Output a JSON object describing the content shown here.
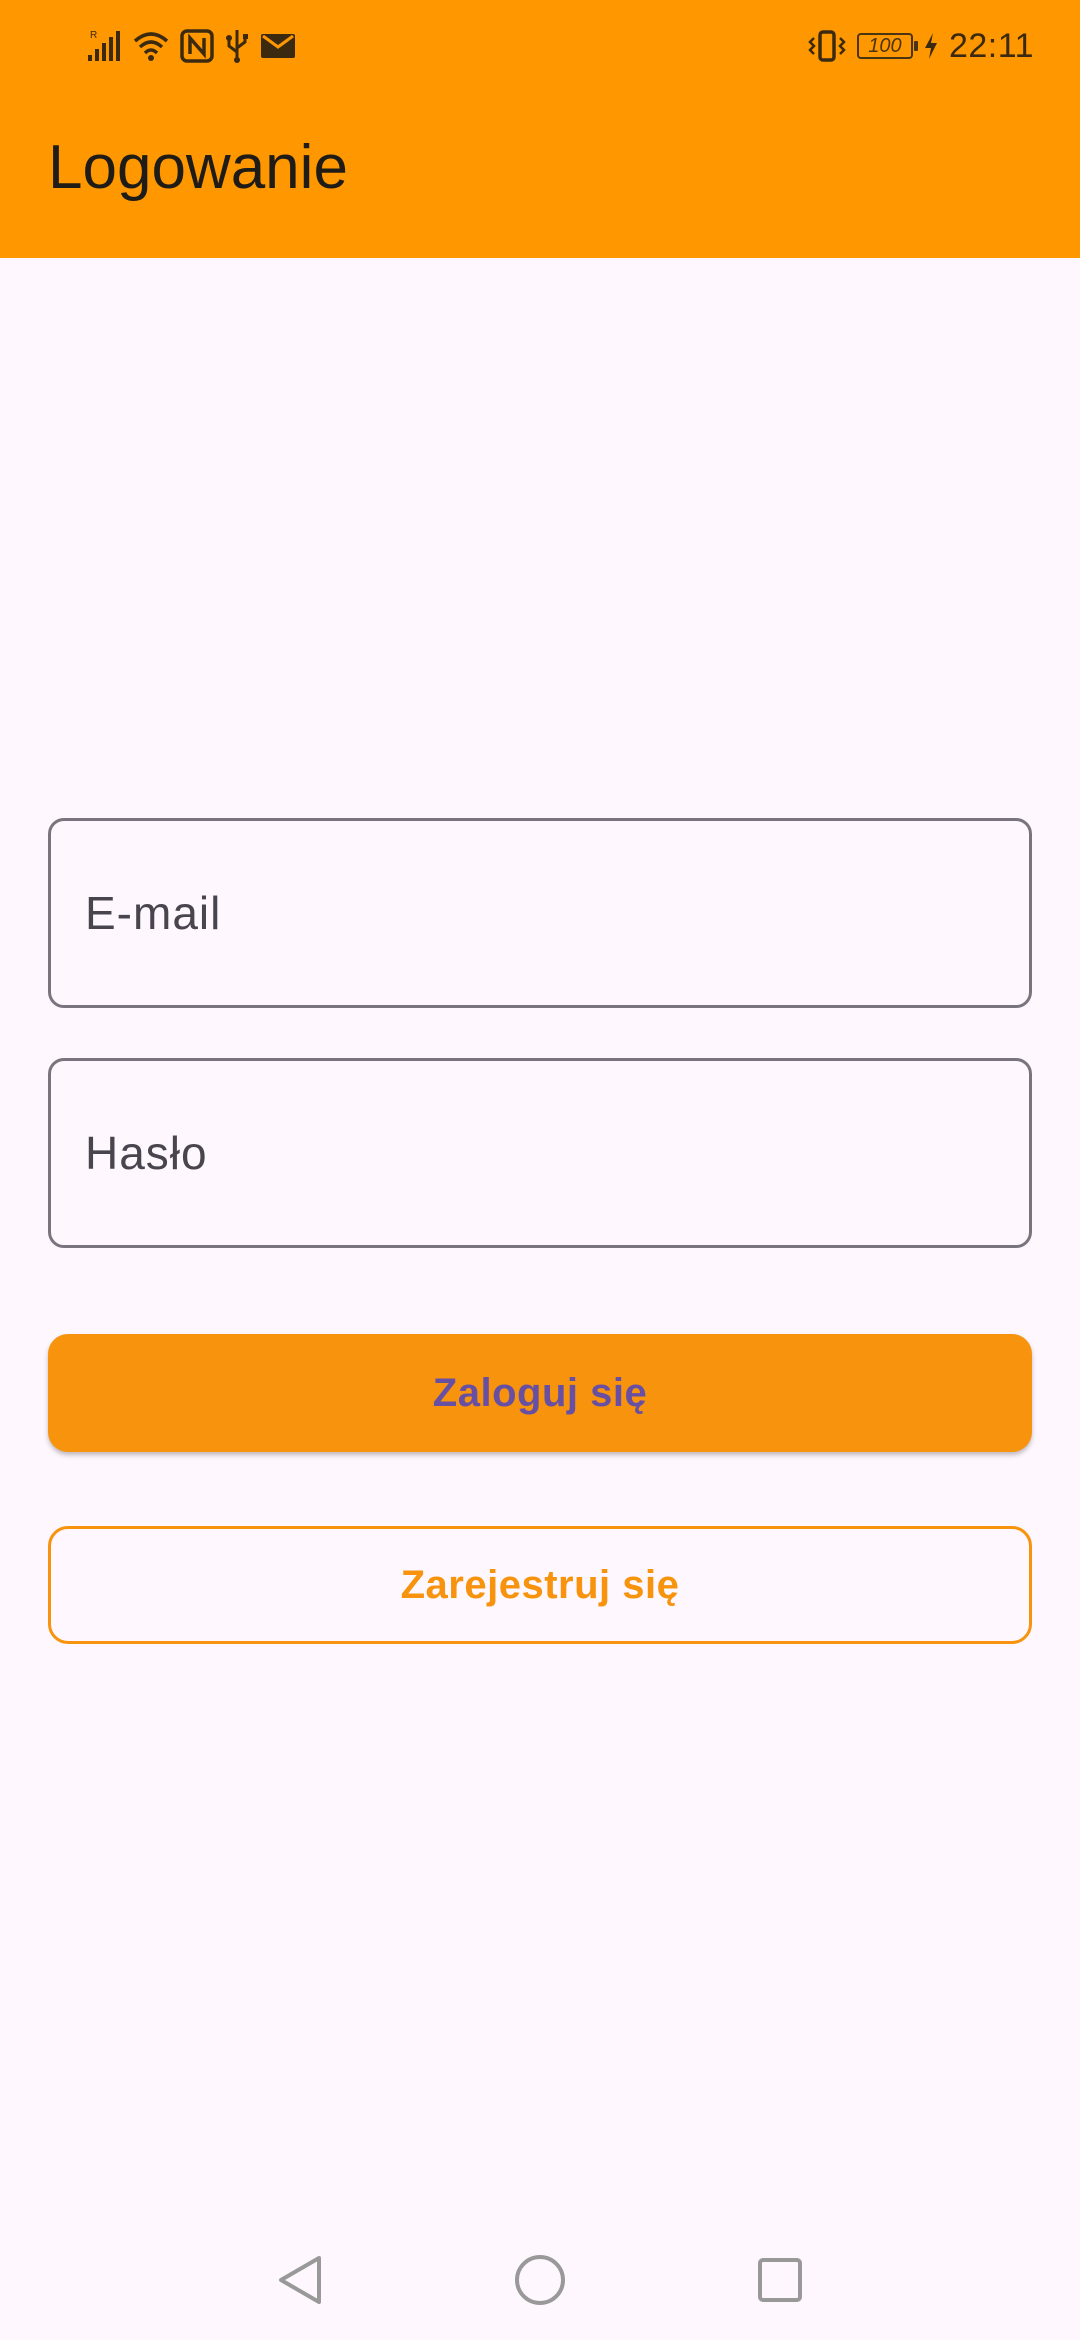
{
  "status_bar": {
    "time": "22:11",
    "battery_level": "100",
    "left_icons": [
      "signal-icon",
      "wifi-icon",
      "nfc-icon",
      "usb-icon",
      "mail-icon"
    ],
    "right_icons": [
      "vibrate-icon",
      "battery-icon",
      "charging-icon"
    ]
  },
  "app_bar": {
    "title": "Logowanie",
    "color": "#FF9800"
  },
  "form": {
    "email_label": "E-mail",
    "password_label": "Hasło",
    "login_button": "Zaloguj się",
    "register_button": "Zarejestruj się"
  },
  "colors": {
    "accent": "#F7930D",
    "button_text": "#6750A4",
    "background": "#FEF7FE"
  },
  "nav_bar": {
    "icons": [
      "back-icon",
      "home-icon",
      "recent-apps-icon"
    ]
  }
}
